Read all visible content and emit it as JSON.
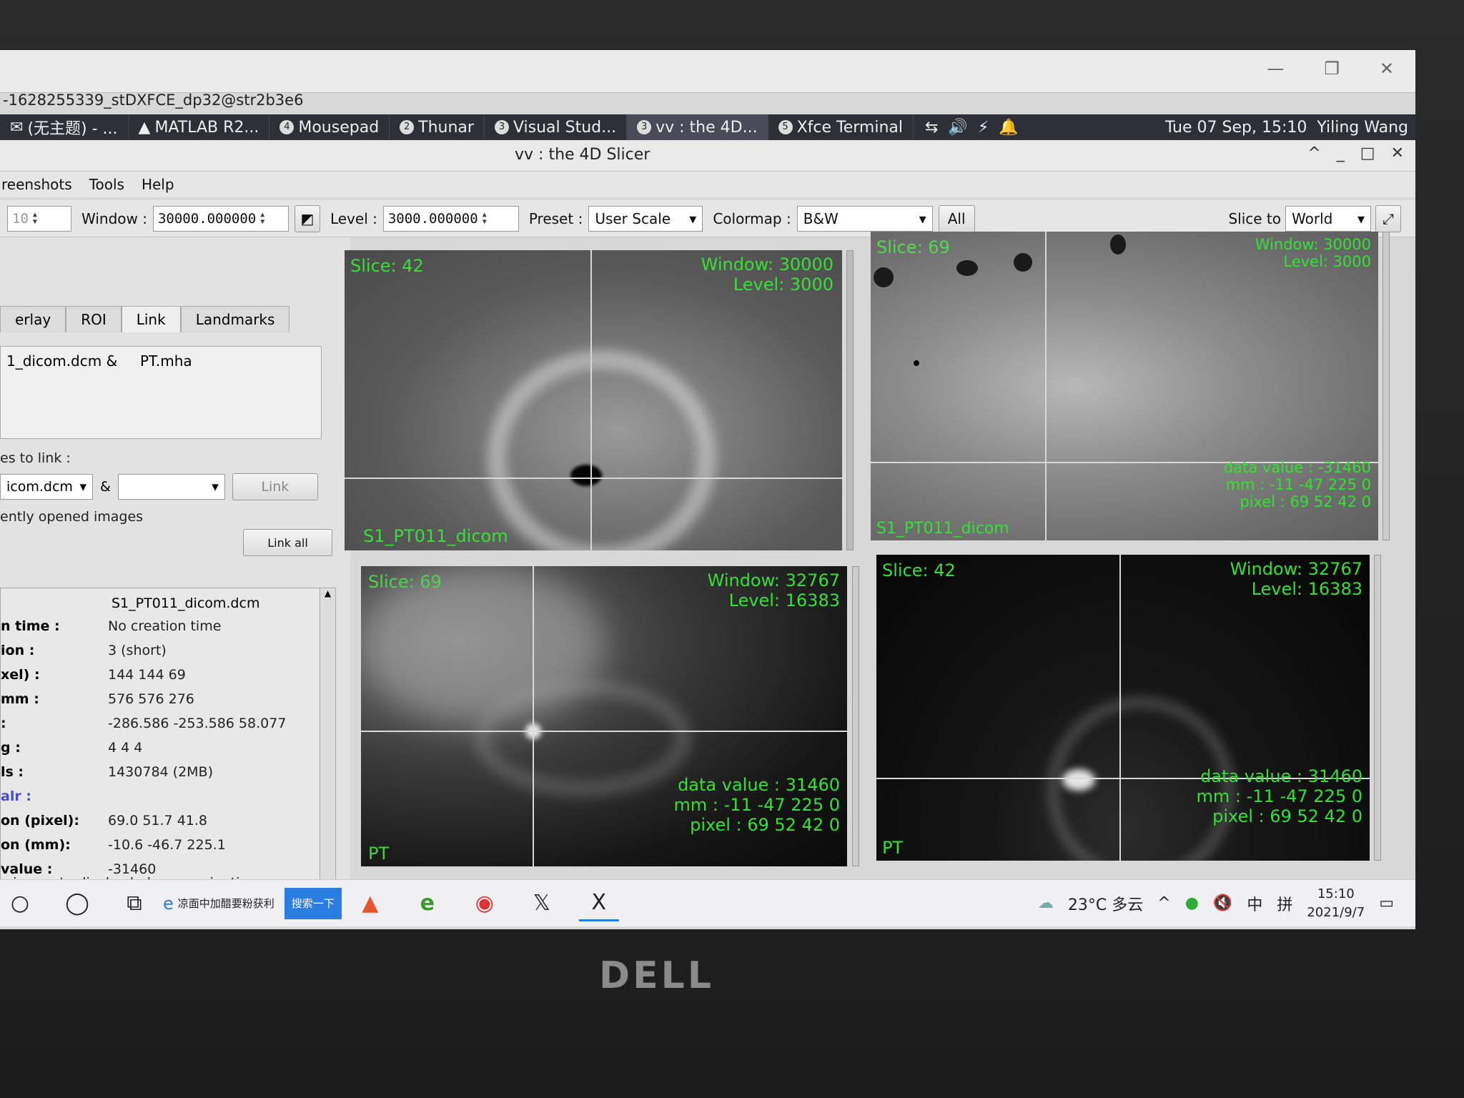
{
  "remote_desktop": {
    "title": "-1628255339_stDXFCE_dp32@str2b3e6"
  },
  "xfce_panel": {
    "tasks": [
      {
        "label": "(无主题) - ...",
        "badge": ""
      },
      {
        "label": "MATLAB R2...",
        "badge": ""
      },
      {
        "label": "Mousepad",
        "badge": "4"
      },
      {
        "label": "Thunar",
        "badge": "2"
      },
      {
        "label": "Visual Stud...",
        "badge": "3"
      },
      {
        "label": "vv : the 4D...",
        "badge": "3"
      },
      {
        "label": "Xfce Terminal",
        "badge": "5"
      }
    ],
    "clock": "Tue 07 Sep, 15:10",
    "user": "Yiling Wang"
  },
  "app": {
    "title": "vv : the 4D Slicer",
    "menu": [
      "reenshots",
      "Tools",
      "Help"
    ],
    "toolbar": {
      "slice_value": "10",
      "window_label": "Window :",
      "window_value": "30000.000000",
      "level_label": "Level :",
      "level_value": "3000.000000",
      "preset_label": "Preset :",
      "preset_value": "User Scale",
      "colormap_label": "Colormap :",
      "colormap_value": "B&W",
      "all_button": "All",
      "slice_to_label": "Slice to",
      "slice_to_value": "World"
    },
    "left": {
      "tabs": [
        "erlay",
        "ROI",
        "Link",
        "Landmarks"
      ],
      "link_pair": "1_dicom.dcm &     PT.mha",
      "images_to_link_label": "es to link :",
      "link_combo_a": "icom.dcm",
      "link_amp": "&",
      "link_combo_b": "",
      "link_button": "Link",
      "recently_label": "ently opened images",
      "link_all_button": "Link all",
      "info_title": "S1_PT011_dicom.dcm",
      "info_rows": [
        {
          "k": "n time :",
          "v": "No creation time"
        },
        {
          "k": "ion :",
          "v": "3 (short)"
        },
        {
          "k": "xel) :",
          "v": "144 144 69"
        },
        {
          "k": "mm :",
          "v": "576 576 276"
        },
        {
          "k": ":",
          "v": "-286.586 -253.586 58.077"
        },
        {
          "k": "g :",
          "v": "4 4 4"
        },
        {
          "k": "ls :",
          "v": "1430784 (2MB)"
        },
        {
          "k": "alr :",
          "v": ""
        },
        {
          "k": "on (pixel):",
          "v": "69.0 51.7 41.8"
        },
        {
          "k": "on (mm):",
          "v": "-10.6 -46.7 225.1"
        },
        {
          "k": "value :",
          "v": "-31460"
        }
      ],
      "status": "n image to display help on navigation"
    },
    "views": {
      "tl": {
        "slice": "Slice: 42",
        "window": "Window: 30000",
        "level": "Level: 3000",
        "name": "S1_PT011_dicom"
      },
      "tr": {
        "slice": "Slice: 69",
        "window": "Window: 30000",
        "level": "Level: 3000",
        "data_value": "data value : -31460",
        "mm": "mm : -11 -47 225 0",
        "pixel": "pixel : 69 52 42 0",
        "name": "S1_PT011_dicom"
      },
      "bl": {
        "slice": "Slice: 69",
        "window": "Window: 32767",
        "level": "Level: 16383",
        "data_value": "data value : 31460",
        "mm": "mm : -11 -47 225 0",
        "pixel": "pixel : 69 52 42 0",
        "name": "PT"
      },
      "br": {
        "slice": "Slice: 42",
        "window": "Window: 32767",
        "level": "Level: 16383",
        "data_value": "data value : 31460",
        "mm": "mm : -11 -47 225 0",
        "pixel": "pixel : 69 52 42 0",
        "name": "PT"
      }
    }
  },
  "windows_taskbar": {
    "search_text": "凉面中加醋要粉获利",
    "search_button": "搜索一下",
    "weather": "23°C 多云",
    "ime": "中",
    "ime2": "拼",
    "time": "15:10",
    "date": "2021/9/7"
  },
  "brand": "DELL",
  "colors": {
    "overlay_green": "#35e035",
    "crosshair": "#d8d8d8"
  }
}
